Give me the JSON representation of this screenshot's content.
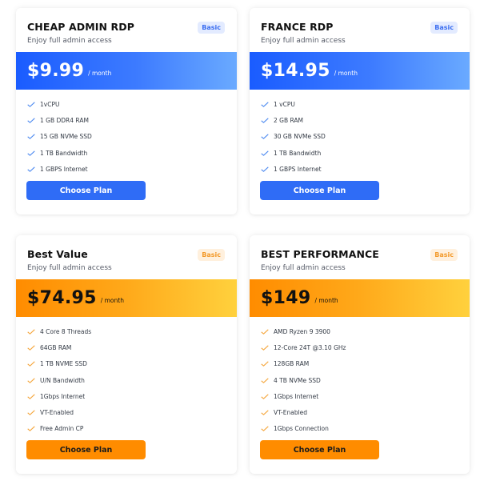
{
  "plans": [
    {
      "title": "CHEAP ADMIN RDP",
      "subtitle": "Enjoy full admin access",
      "badge": "Basic",
      "price": "$9.99",
      "period": "/ month",
      "theme": "blue",
      "features": [
        "1vCPU",
        "1 GB DDR4 RAM",
        "15 GB NVMe SSD",
        "1 TB Bandwidth",
        "1 GBPS Internet"
      ],
      "button": "Choose Plan"
    },
    {
      "title": "FRANCE RDP",
      "subtitle": "Enjoy full admin access",
      "badge": "Basic",
      "price": "$14.95",
      "period": "/ month",
      "theme": "blue",
      "features": [
        "1 vCPU",
        "2 GB RAM",
        "30 GB NVMe SSD",
        "1 TB Bandwidth",
        "1 GBPS Internet"
      ],
      "button": "Choose Plan"
    },
    {
      "title": "Best Value",
      "subtitle": "Enjoy full admin access",
      "badge": "Basic",
      "price": "$74.95",
      "period": "/ month",
      "theme": "orange",
      "features": [
        "4 Core 8 Threads",
        "64GB RAM",
        "1 TB NVME SSD",
        "U/N Bandwidth",
        "1Gbps Internet",
        "VT-Enabled",
        "Free Admin CP"
      ],
      "button": "Choose Plan"
    },
    {
      "title": "BEST PERFORMANCE",
      "subtitle": "Enjoy full admin access",
      "badge": "Basic",
      "price": "$149",
      "period": "/ month",
      "theme": "orange",
      "features": [
        "AMD Ryzen 9 3900",
        "12-Core 24T @3.10 GHz",
        "128GB RAM",
        "4 TB NVMe SSD",
        "1Gbps Internet",
        "VT-Enabled",
        "1Gbps Connection"
      ],
      "button": "Choose Plan"
    }
  ],
  "colors": {
    "blue_accent": "#2f6cf6",
    "orange_accent": "#ff8c00",
    "blue_check": "#4d8af0",
    "orange_check": "#f5a53a"
  }
}
